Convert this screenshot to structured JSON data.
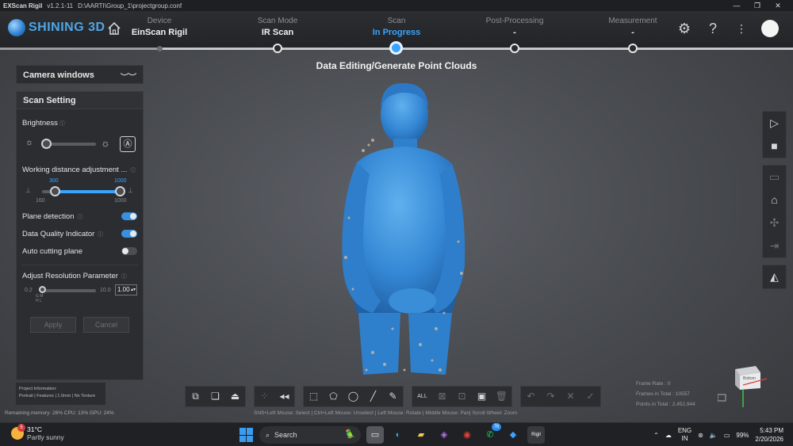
{
  "titlebar": {
    "app": "EXScan Rigil",
    "version": "v1.2.1-11",
    "path": "D:\\AARTI\\Group_1\\projectgroup.conf"
  },
  "brand": {
    "name": "SHINING 3D"
  },
  "steps": [
    {
      "label": "Device",
      "value": "EinScan Rigil"
    },
    {
      "label": "Scan Mode",
      "value": "IR Scan"
    },
    {
      "label": "Scan",
      "value": "In Progress"
    },
    {
      "label": "Post-Processing",
      "value": "-"
    },
    {
      "label": "Measurement",
      "value": "-"
    }
  ],
  "page_title": "Data Editing/Generate Point Clouds",
  "camera_panel": {
    "title": "Camera windows"
  },
  "scan_setting": {
    "title": "Scan Setting",
    "brightness": {
      "label": "Brightness",
      "level": 0.05
    },
    "working_distance": {
      "label": "Working distance adjustment ...",
      "low": "300",
      "high": "1000",
      "min": "160",
      "max": "1000"
    },
    "plane_detection": {
      "label": "Plane detection",
      "on": true
    },
    "data_quality": {
      "label": "Data Quality Indicator",
      "on": true
    },
    "auto_cutting": {
      "label": "Auto cutting plane",
      "on": false
    },
    "resolution": {
      "label": "Adjust Resolution Parameter",
      "min": "0.2",
      "max": "10.0",
      "value": "1.00",
      "ticks": "G M",
      "ticks2": "H L"
    },
    "apply": "Apply",
    "cancel": "Cancel"
  },
  "project_info": {
    "title": "Project Information:",
    "details": "Portrait | Features | 1.0mm | No Texture"
  },
  "status": {
    "memory": "Remaining memory: 26% CPU: 13% GPU: 24%"
  },
  "help_text": "Shift+Left Mouse: Select | Ctrl+Left Mouse: Unselect | Left Mouse: Rotate | Middle Mouse: Pan| Scroll Wheel: Zoom",
  "stats": {
    "frame_rate": "Frame Rate : 0",
    "frames_total": "Frames in Total : 10557",
    "points_total": "Points in Total : 2,452,944"
  },
  "view_cube": {
    "face": "Bottom"
  },
  "taskbar": {
    "weather_temp": "31°C",
    "weather_desc": "Partly sunny",
    "weather_badge": "5",
    "search": "Search",
    "whatsapp_badge": "76",
    "lang1": "ENG",
    "lang2": "IN",
    "battery": "99%",
    "time": "5:43 PM",
    "date": "2/20/2026",
    "rigil_label": "Rigil"
  }
}
